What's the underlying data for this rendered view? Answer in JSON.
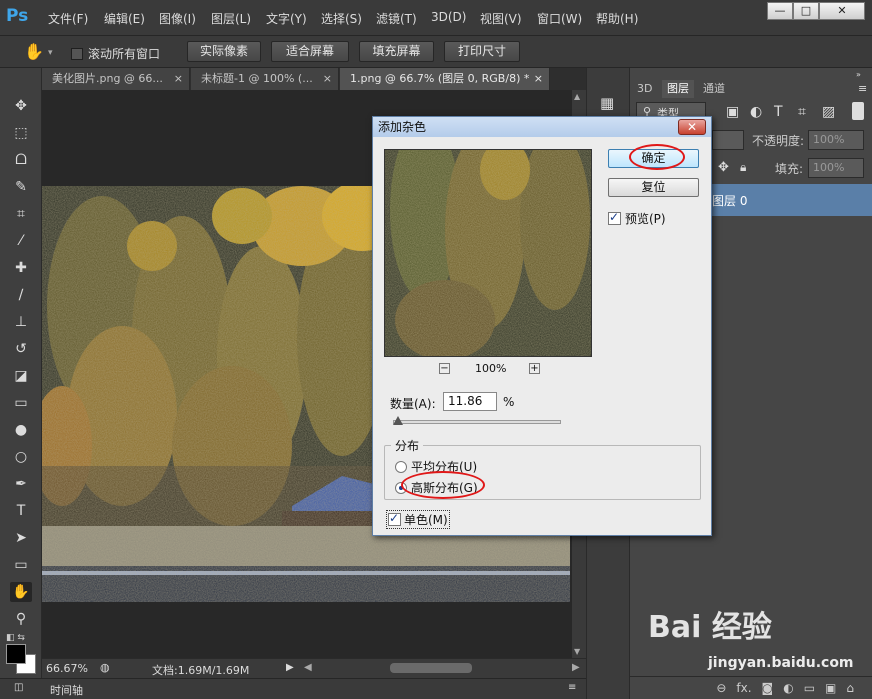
{
  "app": {
    "logo": "Ps"
  },
  "menu": [
    "文件(F)",
    "编辑(E)",
    "图像(I)",
    "图层(L)",
    "文字(Y)",
    "选择(S)",
    "滤镜(T)",
    "3D(D)",
    "视图(V)",
    "窗口(W)",
    "帮助(H)"
  ],
  "window_controls": {
    "minimize": "—",
    "restore": "□",
    "close": "✕"
  },
  "options_bar": {
    "scroll_all_label": "滚动所有窗口",
    "buttons": [
      "实际像素",
      "适合屏幕",
      "填充屏幕",
      "打印尺寸"
    ]
  },
  "tabs": [
    {
      "label": "美化图片.png @ 66...",
      "close": "×"
    },
    {
      "label": "未标题-1 @ 100% (...",
      "close": "×"
    },
    {
      "label": "1.png @ 66.7% (图层 0, RGB/8) *",
      "close": "×"
    }
  ],
  "status": {
    "zoom": "66.67%",
    "doc": "文档:1.69M/1.69M"
  },
  "timeline_label": "时间轴",
  "panel": {
    "tabs": [
      "3D",
      "图层",
      "通道"
    ],
    "kind_label": "类型",
    "opacity_label": "不透明度:",
    "opacity_value": "100%",
    "fill_label": "填充:",
    "fill_value": "100%",
    "layer_name": "图层 0"
  },
  "dialog": {
    "title": "添加杂色",
    "ok_label": "确定",
    "reset_label": "复位",
    "preview_label": "预览(P)",
    "preview_checked": true,
    "zoom_value": "100%",
    "amount_label": "数量(A):",
    "amount_value": "11.86",
    "amount_unit": "%",
    "amount_fraction": 0.03,
    "distribution_title": "分布",
    "uniform_label": "平均分布(U)",
    "gaussian_label": "高斯分布(G)",
    "selected_distribution": "gaussian",
    "mono_label": "单色(M)",
    "mono_checked": true,
    "close": "✕"
  },
  "watermark": {
    "brand": "Bai 经验",
    "url": "jingyan.baidu.com"
  },
  "colors": {
    "ps_blue": "#3fa6ea",
    "highlight_red": "#e01818",
    "dialog_bg": "#ececec"
  }
}
